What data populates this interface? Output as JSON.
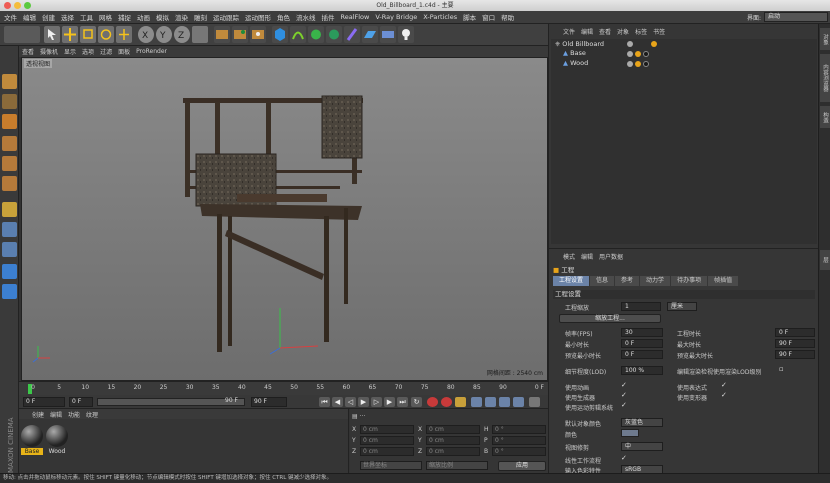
{
  "window": {
    "title": "Old_Billboard_1.c4d - 主要"
  },
  "menubar": {
    "items": [
      "文件",
      "编辑",
      "创建",
      "选择",
      "工具",
      "网格",
      "捕捉",
      "动画",
      "模拟",
      "渲染",
      "雕刻",
      "运动跟踪",
      "运动图形",
      "角色",
      "流水线",
      "插件",
      "RealFlow",
      "V-Ray Bridge",
      "X-Particles",
      "脚本",
      "窗口",
      "帮助"
    ],
    "layout_label": "界面:",
    "layout_value": "启动"
  },
  "viewport": {
    "menu": [
      "查看",
      "摄像机",
      "显示",
      "选项",
      "过滤",
      "面板",
      "ProRender"
    ],
    "label": "透视视图",
    "grid_readout": "网格间距 : 2540 cm"
  },
  "timeline": {
    "ticks": [
      "0",
      "5",
      "10",
      "15",
      "20",
      "25",
      "30",
      "35",
      "40",
      "45",
      "50",
      "55",
      "60",
      "65",
      "70",
      "75",
      "80",
      "85",
      "90"
    ],
    "current_frame": "0 F"
  },
  "transport": {
    "start": "0 F",
    "current": "0 F",
    "end_range": "90 F",
    "end": "90 F"
  },
  "materials": {
    "menu": [
      "创建",
      "编辑",
      "功能",
      "纹理"
    ],
    "items": [
      {
        "name": "Base"
      },
      {
        "name": "Wood"
      }
    ]
  },
  "coordinates": {
    "rows": [
      {
        "axis1": "X",
        "val1": "0 cm",
        "val2": "0 cm",
        "axis3": "H",
        "val3": "0 °"
      },
      {
        "axis1": "Y",
        "val1": "0 cm",
        "val2": "0 cm",
        "axis3": "P",
        "val3": "0 °"
      },
      {
        "axis1": "Z",
        "val1": "0 cm",
        "val2": "0 cm",
        "axis3": "B",
        "val3": "0 °"
      }
    ],
    "mode1": "世界坐标",
    "mode2": "缩放比例",
    "apply": "应用"
  },
  "objects": {
    "menu": [
      "文件",
      "编辑",
      "查看",
      "对象",
      "标签",
      "书签"
    ],
    "tree": [
      {
        "name": "Old Billboard",
        "level": 0
      },
      {
        "name": "Base",
        "level": 1
      },
      {
        "name": "Wood",
        "level": 1
      }
    ]
  },
  "attributes": {
    "menu": [
      "模式",
      "编辑",
      "用户数据"
    ],
    "title": "工程",
    "tabs": [
      "工程设置",
      "信息",
      "参考",
      "动力学",
      "待办事项",
      "帧插值"
    ],
    "section": "工程设置",
    "scale_label": "工程缩放",
    "scale_value": "1",
    "scale_unit": "厘米",
    "scale_btn": "缩放工程...",
    "fps_label": "帧率(FPS)",
    "fps_value": "30",
    "project_time_label": "工程时长",
    "project_time_value": "0 F",
    "min_time_label": "最小时长",
    "min_time_value": "0 F",
    "max_time_label": "最大时长",
    "max_time_value": "90 F",
    "preview_min_label": "预览最小时长",
    "preview_min_value": "0 F",
    "preview_max_label": "预览最大时长",
    "preview_max_value": "90 F",
    "lod_label": "细节程度(LOD)",
    "lod_value": "100 %",
    "lod_render_label": "编辑渲染检视使用渲染LOD级别",
    "use_anim_label": "使用动画",
    "use_expr_label": "使用表达式",
    "use_gen_label": "使用生成器",
    "use_deform_label": "使用变形器",
    "use_motion_label": "使用运动剪辑系统",
    "default_color_label": "默认对象颜色",
    "default_color_value": "灰蓝色",
    "color_label": "颜色",
    "clip_label": "视图修剪",
    "clip_value": "中",
    "linear_label": "线性工作流程",
    "input_color_label": "输入色彩特性",
    "input_color_value": "sRGB"
  },
  "side_tabs": [
    "对象",
    "内容浏览器",
    "构造",
    "层"
  ],
  "status": "移动: 点击并拖动鼠标移动元素。按住 SHIFT 键量化移动；节点编辑模式时按住 SHIFT 键增加选择对象；按住 CTRL 键减少选择对象。",
  "brand": "MAXON CINEMA 4D"
}
